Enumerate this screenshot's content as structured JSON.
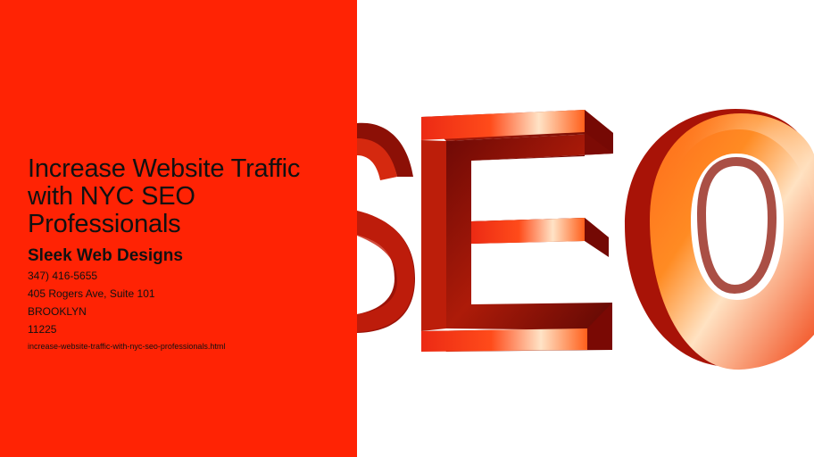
{
  "slide": {
    "title": "Increase Website Traffic with NYC SEO Professionals",
    "company": "Sleek Web Designs",
    "phone": "347) 416-5655",
    "address": "405 Rogers Ave, Suite 101",
    "city": "BROOKLYN",
    "zip": "11225",
    "file_link": "increase-website-traffic-with-nyc-seo-professionals.html"
  },
  "image": {
    "description_icon": "seo-3d-letters-icon",
    "letters": [
      "S",
      "E",
      "O"
    ]
  },
  "colors": {
    "panel_red": "#ff2304",
    "text_dark": "#111111",
    "letter_red": "#e72a12",
    "letter_orange": "#ff7d1b",
    "letter_shadow": "#8d1407",
    "background": "#ffffff"
  }
}
